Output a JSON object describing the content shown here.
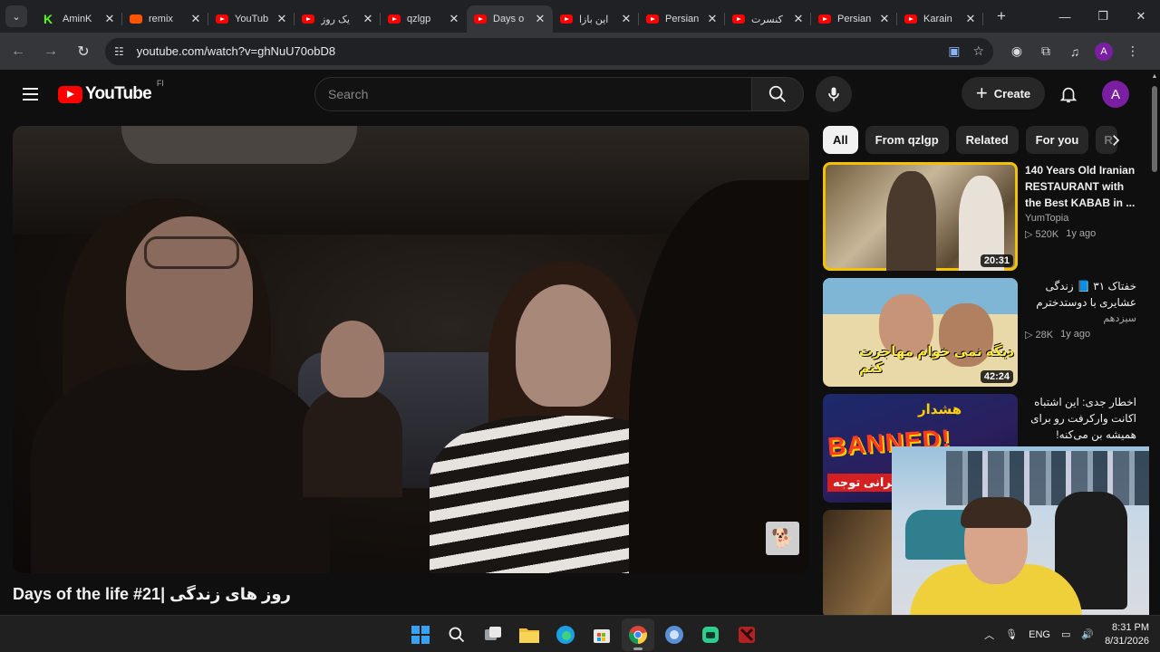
{
  "browser": {
    "tabs": [
      {
        "title": "AminK",
        "favicon": "kick-icon"
      },
      {
        "title": "remix",
        "favicon": "soundcloud-icon"
      },
      {
        "title": "YouTub",
        "favicon": "youtube-icon"
      },
      {
        "title": "یک روز",
        "favicon": "youtube-icon"
      },
      {
        "title": "qzlgp",
        "favicon": "youtube-icon"
      },
      {
        "title": "Days o",
        "favicon": "youtube-icon",
        "active": true
      },
      {
        "title": "این بازا",
        "favicon": "youtube-icon"
      },
      {
        "title": "Persian",
        "favicon": "youtube-icon"
      },
      {
        "title": "کنسرت",
        "favicon": "youtube-icon"
      },
      {
        "title": "Persian",
        "favicon": "youtube-icon"
      },
      {
        "title": "Karain",
        "favicon": "youtube-icon"
      }
    ],
    "url": "youtube.com/watch?v=ghNuU70obD8",
    "profile_initial": "A"
  },
  "youtube": {
    "logo_text": "YouTube",
    "country_code": "FI",
    "search_placeholder": "Search",
    "create_label": "Create",
    "avatar_initial": "A",
    "video_title": "Days of the life #21| روز های زندگی",
    "chips": [
      "All",
      "From qzlgp",
      "Related",
      "For you",
      "R"
    ],
    "recommendations": [
      {
        "title": "140 Years Old Iranian RESTAURANT with the Best KABAB in ...",
        "channel": "YumTopia",
        "views": "520K",
        "age": "1y ago",
        "duration": "20:31",
        "rtl": false
      },
      {
        "title": "خفتاک ۳۱ 📘 زندگی عشایری با دوستدخترم",
        "channel": "سیزدهم",
        "views": "28K",
        "age": "1y ago",
        "duration": "42:24",
        "thumb_text": "دیگه نمی خوام مهاجرت کنم",
        "rtl": true
      },
      {
        "title": "اخطار جدی: این اشتباه اکانت وارکرفت رو برای همیشه بن می‌کنه!",
        "thumb_text_1": "هشدار",
        "thumb_text_2": "BANNED!",
        "thumb_text_3": "ایرانی توجه!",
        "rtl": true
      }
    ]
  },
  "taskbar": {
    "language": "ENG",
    "time": "8:31 PM",
    "date": "8/31/2026"
  },
  "colors": {
    "youtube_red": "#ff0000",
    "background": "#0f0f0f",
    "avatar": "#7b1fa2"
  }
}
